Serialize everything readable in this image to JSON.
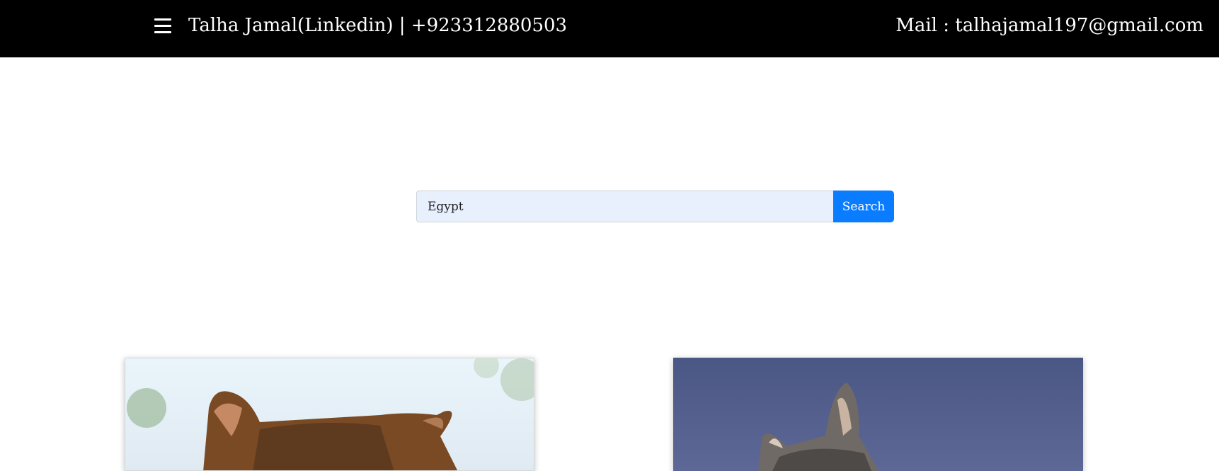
{
  "header": {
    "menu_icon": "hamburger-menu-icon",
    "brand_text": "Talha Jamal(Linkedin) | +923312880503",
    "mail_text": "Mail : talhajamal197@gmail.com"
  },
  "search": {
    "value": "Egypt",
    "button_label": "Search"
  },
  "results": [
    {
      "type": "image",
      "subject": "cat"
    },
    {
      "type": "image",
      "subject": "cat"
    }
  ]
}
